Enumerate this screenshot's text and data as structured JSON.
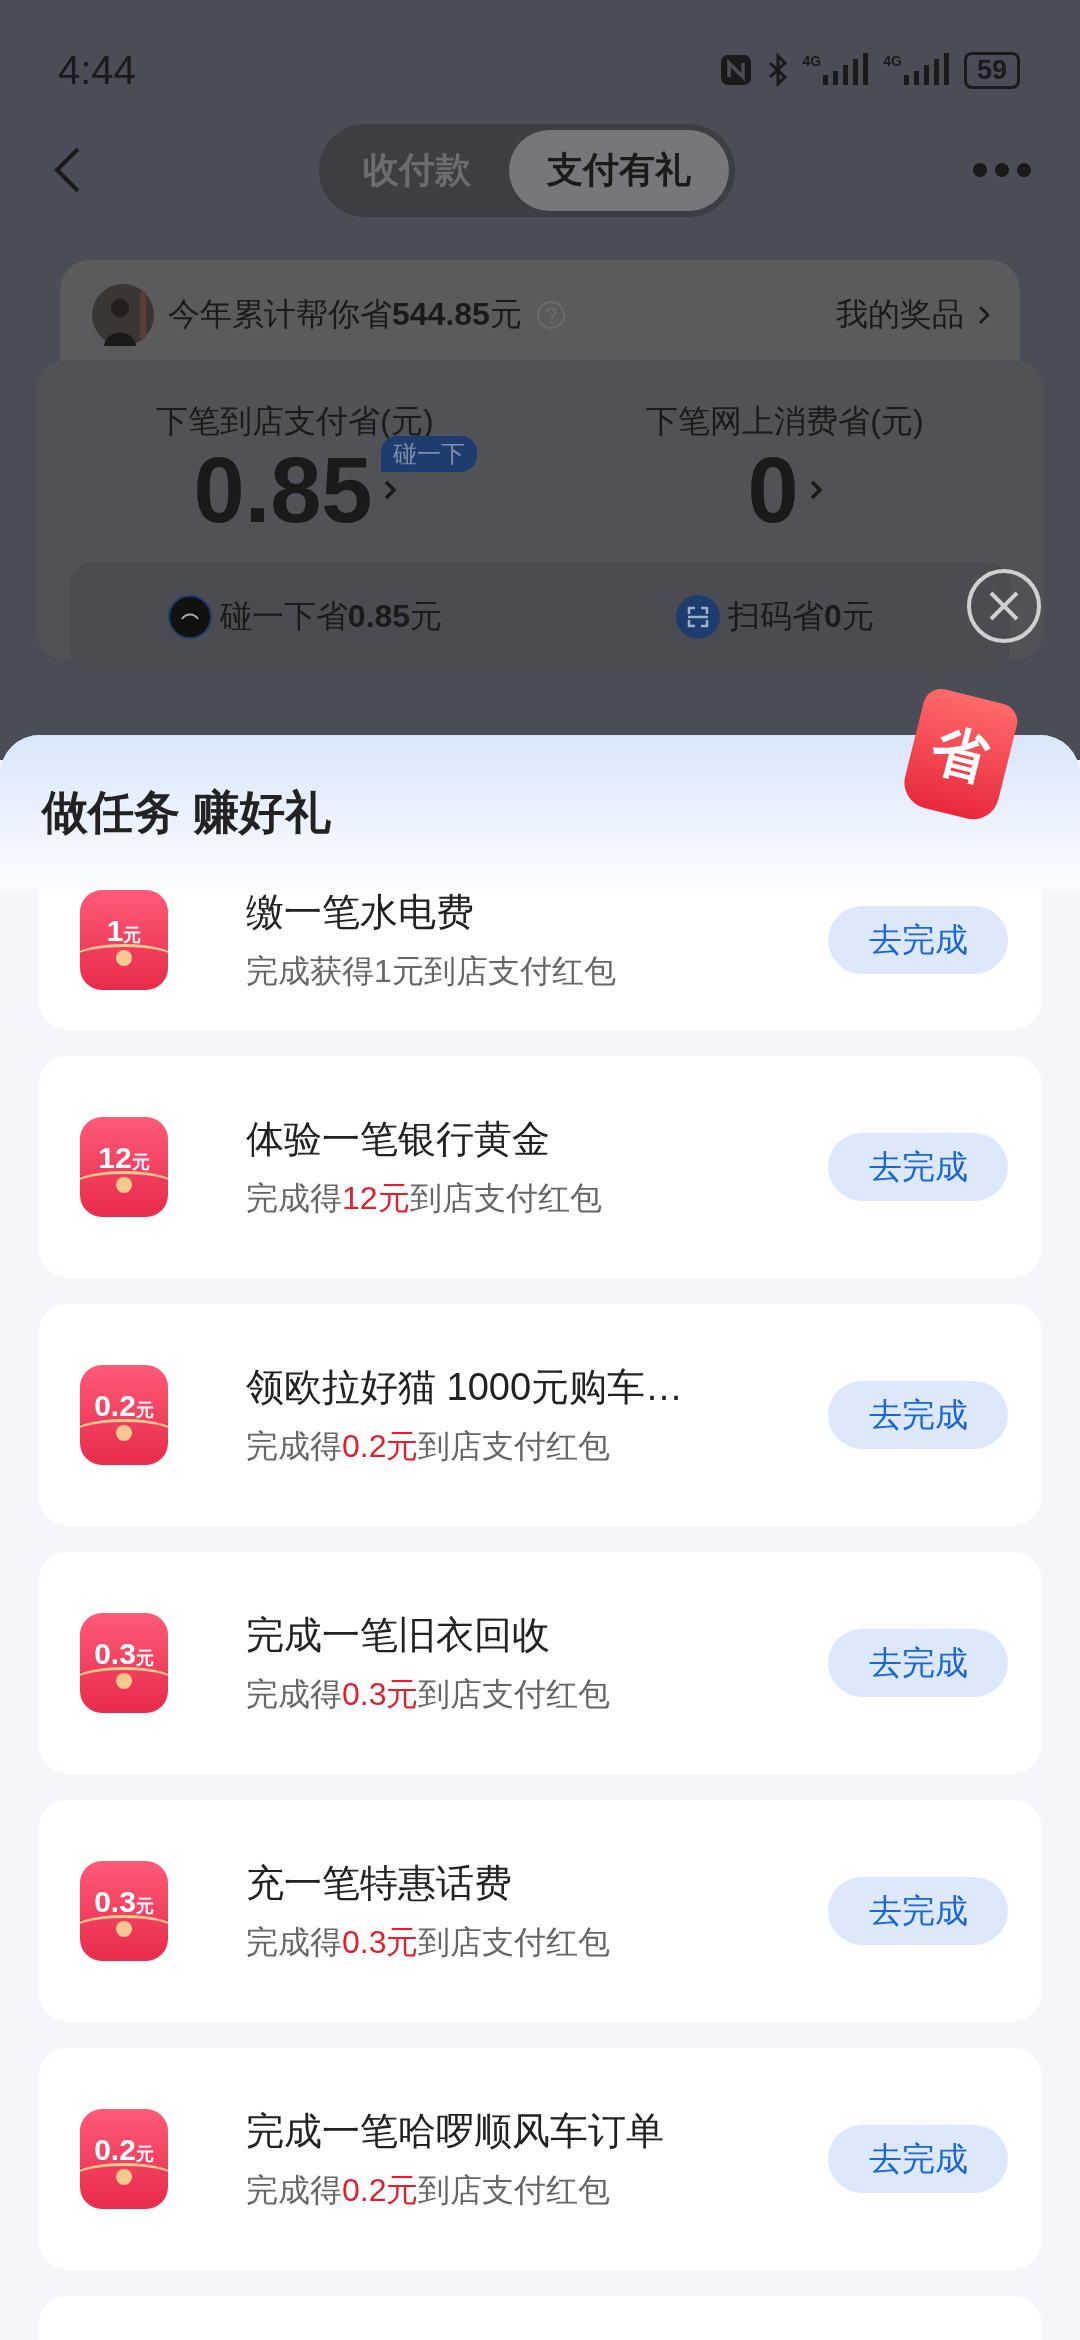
{
  "status_bar": {
    "time": "4:44",
    "networks": [
      "4G",
      "4G"
    ],
    "battery": "59"
  },
  "nav": {
    "tabs": [
      {
        "label": "收付款",
        "selected": false
      },
      {
        "label": "支付有礼",
        "selected": true
      }
    ]
  },
  "savings": {
    "text": "今年累计帮你省**544.85**元",
    "link": "我的奖品"
  },
  "stats": {
    "columns": [
      {
        "label": "下笔到店支付省(元)",
        "value": "0.85",
        "badge": "碰一下"
      },
      {
        "label": "下笔网上消费省(元)",
        "value": "0"
      }
    ],
    "methods": [
      {
        "kind": "tap",
        "text": "碰一下省**0.85**元"
      },
      {
        "kind": "scan",
        "text": "扫码省**0**元"
      }
    ]
  },
  "sheet": {
    "title": "做任务 赚好礼",
    "tag": "省",
    "tasks": [
      {
        "amount": "1",
        "unit": "元",
        "title": "缴一笔水电费",
        "reward": [
          {
            "text": "完成获得1元到店支付红包",
            "highlight": false
          }
        ],
        "button": "去完成"
      },
      {
        "amount": "12",
        "unit": "元",
        "title": "体验一笔银行黄金",
        "reward": [
          {
            "text": "完成得",
            "highlight": false
          },
          {
            "text": "12元",
            "highlight": true
          },
          {
            "text": "到店支付红包",
            "highlight": false
          }
        ],
        "button": "去完成"
      },
      {
        "amount": "0.2",
        "unit": "元",
        "title": "领欧拉好猫 1000元购车…",
        "reward": [
          {
            "text": "完成得",
            "highlight": false
          },
          {
            "text": "0.2元",
            "highlight": true
          },
          {
            "text": "到店支付红包",
            "highlight": false
          }
        ],
        "button": "去完成"
      },
      {
        "amount": "0.3",
        "unit": "元",
        "title": "完成一笔旧衣回收",
        "reward": [
          {
            "text": "完成得",
            "highlight": false
          },
          {
            "text": "0.3元",
            "highlight": true
          },
          {
            "text": "到店支付红包",
            "highlight": false
          }
        ],
        "button": "去完成"
      },
      {
        "amount": "0.3",
        "unit": "元",
        "title": "充一笔特惠话费",
        "reward": [
          {
            "text": "完成得",
            "highlight": false
          },
          {
            "text": "0.3元",
            "highlight": true
          },
          {
            "text": "到店支付红包",
            "highlight": false
          }
        ],
        "button": "去完成"
      },
      {
        "amount": "0.2",
        "unit": "元",
        "title": "完成一笔哈啰顺风车订单",
        "reward": [
          {
            "text": "完成得",
            "highlight": false
          },
          {
            "text": "0.2元",
            "highlight": true
          },
          {
            "text": "到店支付红包",
            "highlight": false
          }
        ],
        "button": "去完成"
      }
    ]
  }
}
